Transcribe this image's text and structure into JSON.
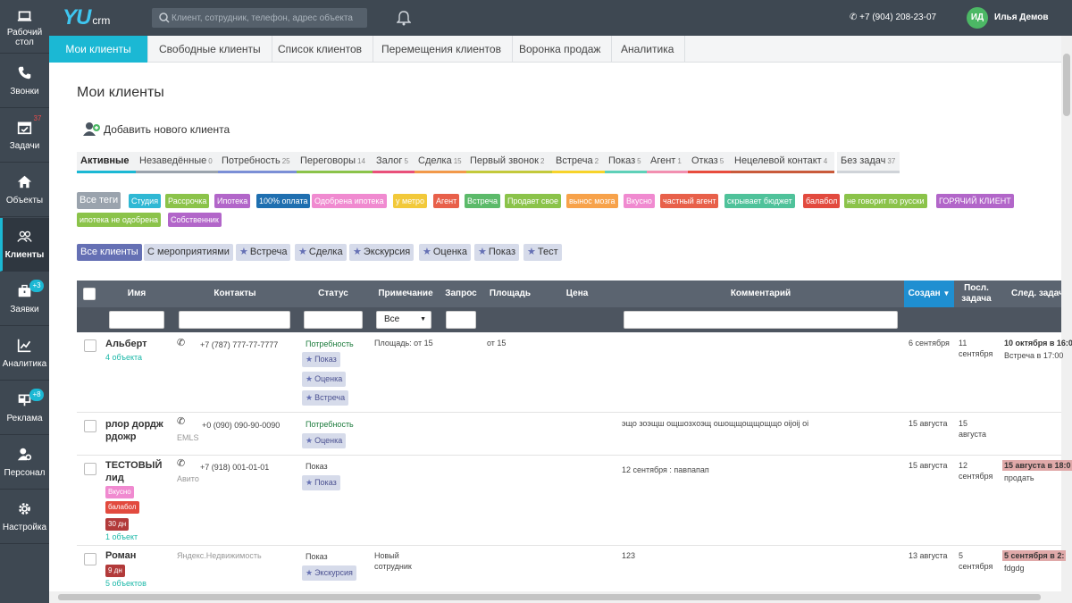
{
  "app": {
    "logo_main": "YU",
    "logo_sub": "crm"
  },
  "search": {
    "placeholder": "Клиент, сотрудник, телефон, адрес объекта"
  },
  "header": {
    "phone": "+7 (904) 208-23-07",
    "user_initials": "ИД",
    "user_name": "Илья Демов"
  },
  "sidebar": {
    "items": [
      {
        "label": "Рабочий стол",
        "icon": "laptop-icon"
      },
      {
        "label": "Звонки",
        "icon": "phone-icon"
      },
      {
        "label": "Задачи",
        "icon": "calendar-icon",
        "badge": "37"
      },
      {
        "label": "Объекты",
        "icon": "home-icon"
      },
      {
        "label": "Клиенты",
        "icon": "users-icon"
      },
      {
        "label": "Заявки",
        "icon": "briefcase-icon",
        "badge": "+3"
      },
      {
        "label": "Аналитика",
        "icon": "chart-icon"
      },
      {
        "label": "Реклама",
        "icon": "billboard-icon",
        "badge": "+8"
      },
      {
        "label": "Персонал",
        "icon": "user-gear-icon"
      },
      {
        "label": "Настройка",
        "icon": "gear-icon"
      }
    ]
  },
  "navtabs": [
    "Мои клиенты",
    "Свободные клиенты",
    "Список клиентов",
    "Перемещения клиентов",
    "Воронка продаж",
    "Аналитика"
  ],
  "page": {
    "title": "Мои клиенты",
    "add_client": "Добавить нового клиента"
  },
  "stages": [
    {
      "label": "Активные",
      "count": "",
      "color": "#1bb8d4"
    },
    {
      "label": "Незаведённые",
      "count": "0",
      "color": "#9aa3ad"
    },
    {
      "label": "Потребность",
      "count": "25",
      "color": "#7b8fd6"
    },
    {
      "label": "Переговоры",
      "count": "14",
      "color": "#8bc34a"
    },
    {
      "label": "Залог",
      "count": "5",
      "color": "#e9507a"
    },
    {
      "label": "Сделка",
      "count": "15",
      "color": "#f2994a"
    },
    {
      "label": "Первый звонок",
      "count": "2",
      "color": "#c3c93a"
    },
    {
      "label": "Встреча",
      "count": "2",
      "color": "#f7d32a"
    },
    {
      "label": "Показ",
      "count": "5",
      "color": "#5ed0b8"
    },
    {
      "label": "Агент",
      "count": "1",
      "color": "#f28fb0"
    },
    {
      "label": "Отказ",
      "count": "5",
      "color": "#e84c3d"
    },
    {
      "label": "Нецелевой контакт",
      "count": "4",
      "color": "#c95a3a"
    },
    {
      "label": "Без задач",
      "count": "37",
      "color": "#cfd3d8"
    }
  ],
  "tags": [
    {
      "label": "Все теги",
      "color": "#9aa3ad"
    },
    {
      "label": "Студия",
      "color": "#2fb8d4"
    },
    {
      "label": "Рассрочка",
      "color": "#8bc34a"
    },
    {
      "label": "Ипотека",
      "color": "#b266c9"
    },
    {
      "label": "100% оплата",
      "color": "#1f6fb0"
    },
    {
      "label": "Одобрена ипотека",
      "color": "#f08ad0"
    },
    {
      "label": "у метро",
      "color": "#f2c93a"
    },
    {
      "label": "Агент",
      "color": "#e8604a"
    },
    {
      "label": "Встреча",
      "color": "#5cba6a"
    },
    {
      "label": "Продает свое",
      "color": "#8bc34a"
    },
    {
      "label": "вынос мозга",
      "color": "#f7a24a"
    },
    {
      "label": "Вкусно",
      "color": "#f08ad0"
    },
    {
      "label": "частный агент",
      "color": "#e8604a"
    },
    {
      "label": "скрывает бюджет",
      "color": "#4fc29a"
    },
    {
      "label": "балабол",
      "color": "#e24a3e"
    },
    {
      "label": "не говорит по русски",
      "color": "#8bc34a"
    },
    {
      "label": "ГОРЯЧИЙ КЛИЕНТ",
      "color": "#b266c9"
    },
    {
      "label": "ипотека не одобрена",
      "color": "#8bc34a"
    },
    {
      "label": "Собственник",
      "color": "#b266c9"
    }
  ],
  "filters": [
    "Все клиенты",
    "С мероприятиями",
    "Встреча",
    "Сделка",
    "Экскурсия",
    "Оценка",
    "Показ",
    "Тест"
  ],
  "table": {
    "columns": [
      "Имя",
      "Контакты",
      "Статус",
      "Примечание",
      "Запрос",
      "Площадь",
      "Цена",
      "Комментарий",
      "Создан",
      "Посл. задача",
      "След. задача"
    ],
    "filter_select": "Все",
    "rows": [
      {
        "name": "Альберт",
        "objects": "4 объекта",
        "phone": "+7 (787) 777-77-7777",
        "source": "",
        "status": "Потребность",
        "events": [
          "Показ",
          "Оценка",
          "Встреча"
        ],
        "note": "Площадь: от 15",
        "area": "от 15",
        "comment": "",
        "created": "6 сентября",
        "last_task": "11 сентября",
        "next_task": "10 октября в 16:0",
        "next_task_sub": "Встреча в 17:00"
      },
      {
        "name": "рлор дордж рдожр",
        "objects": "",
        "phone": "+0 (090) 090-90-0090",
        "source": "EMLS",
        "status": "Потребность",
        "events": [
          "Оценка"
        ],
        "note": "",
        "area": "",
        "comment": "эщо зоэщш ощшозхоэщ ошощщощщощщо оijоij оi",
        "created": "15 августа",
        "last_task": "15 августа",
        "next_task": "",
        "next_task_sub": ""
      },
      {
        "name": "ТЕСТОВЫЙ лид",
        "objects": "1 объект",
        "phone": "+7 (918) 001-01-01",
        "source": "Авито",
        "status": "Показ",
        "events": [
          "Показ"
        ],
        "tags": [
          "Вкусно",
          "балабол",
          "30 дн"
        ],
        "note": "",
        "area": "",
        "comment": "12 сентября : павпапап",
        "created": "15 августа",
        "last_task": "12 сентября",
        "next_task": "15 августа в 18:0",
        "next_task_sub": "продать"
      },
      {
        "name": "Роман",
        "objects": "5 объектов",
        "phone": "",
        "source": "Яндекс.Недвижимость",
        "status": "Показ",
        "events": [
          "Экскурсия"
        ],
        "tags": [
          "9 дн"
        ],
        "note": "Новый сотрудник",
        "area": "",
        "comment": "123",
        "created": "13 августа",
        "last_task": "5 сентября",
        "next_task": "5 сентября в 2:",
        "next_task_sub": "fdgdg"
      }
    ]
  }
}
